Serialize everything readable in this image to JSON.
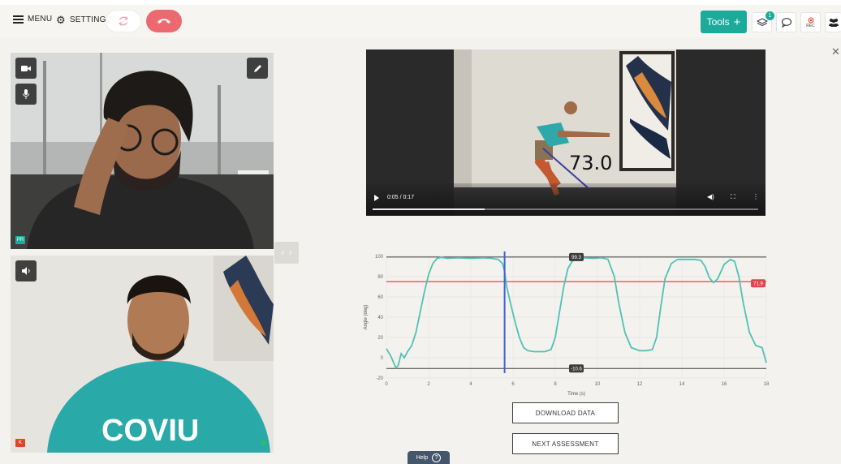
{
  "toolbar": {
    "menu_label": "MENU",
    "settings_label": "SETTINGS",
    "tools_label": "Tools",
    "notification_count": "1",
    "rec_label": "REC",
    "accent_color": "#1cab9b",
    "hangup_color": "#ec6a6f"
  },
  "participants": [
    {
      "tag": "PR",
      "tag_color": "#1cab9b"
    },
    {
      "tag": "K",
      "tag_color": "#e0452a"
    }
  ],
  "video": {
    "time": "0:05 / 0:17",
    "progress": 0.29,
    "overlay_angle": "73.0"
  },
  "buttons": {
    "download": "DOWNLOAD DATA",
    "next": "NEXT ASSESSMENT",
    "help": "Help"
  },
  "chart_data": {
    "type": "line",
    "xlabel": "Time (s)",
    "ylabel": "Angle (deg)",
    "xlim": [
      0,
      18
    ],
    "ylim": [
      -20,
      100
    ],
    "xticks": [
      0,
      2,
      4,
      6,
      8,
      10,
      12,
      14,
      16,
      18
    ],
    "yticks": [
      -20,
      0,
      20,
      40,
      60,
      80,
      100
    ],
    "grid": true,
    "series": [
      {
        "color": "#4fc2b3",
        "x": [
          0,
          0.2,
          0.45,
          0.55,
          0.7,
          0.85,
          1.0,
          1.2,
          1.4,
          1.6,
          1.8,
          2.0,
          2.2,
          2.4,
          2.6,
          2.9,
          3.4,
          4.0,
          4.6,
          5.0,
          5.3,
          5.5,
          5.6,
          5.7,
          5.9,
          6.1,
          6.3,
          6.5,
          6.7,
          7.0,
          7.5,
          7.8,
          8.0,
          8.2,
          8.4,
          8.6,
          8.8,
          9.0,
          9.3,
          9.8,
          10.2,
          10.5,
          10.8,
          11.0,
          11.3,
          11.6,
          12.0,
          12.3,
          12.6,
          12.8,
          13.0,
          13.2,
          13.5,
          13.8,
          14.2,
          14.6,
          14.9,
          15.1,
          15.3,
          15.5,
          15.7,
          16.0,
          16.3,
          16.5,
          16.7,
          16.9,
          17.2,
          17.5,
          17.8,
          18.0
        ],
        "y": [
          9,
          2,
          -10,
          -8,
          4,
          0,
          6,
          12,
          25,
          45,
          65,
          82,
          93,
          98,
          99,
          98,
          98.5,
          98,
          98.5,
          98,
          97,
          93,
          85,
          70,
          52,
          35,
          20,
          10,
          7,
          6,
          6,
          8,
          20,
          45,
          70,
          88,
          95,
          98,
          98.5,
          98,
          98.5,
          97,
          80,
          55,
          25,
          10,
          7,
          7,
          8,
          20,
          50,
          78,
          93,
          97,
          97,
          97,
          96,
          90,
          79,
          74,
          78,
          92,
          97,
          95,
          80,
          55,
          25,
          12,
          10,
          -5
        ]
      }
    ],
    "annotations": {
      "vertical_time": 5.6,
      "upper_value": "99.3",
      "lower_value": "-10.6",
      "threshold_value": "71.9",
      "upper_line": 99.3,
      "lower_line": -10.6,
      "threshold_line": 75,
      "upper_color": "#3d3d3d",
      "threshold_color": "#e8424f",
      "cursor_color": "#3f63d6"
    }
  }
}
